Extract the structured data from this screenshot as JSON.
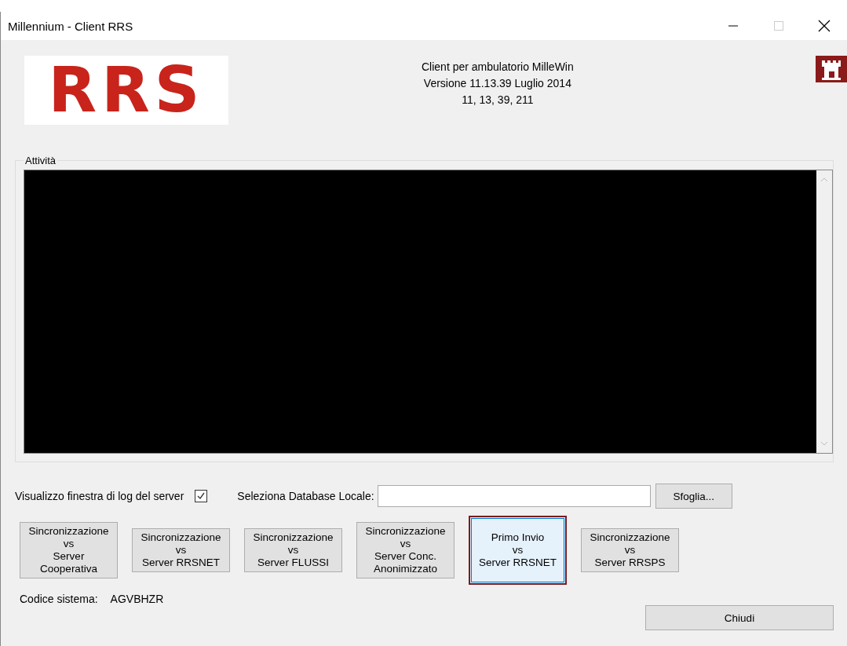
{
  "window": {
    "title": "Millennium - Client RRS"
  },
  "header": {
    "logo_text": "RRS",
    "info_lines": [
      "Client per ambulatorio MilleWin",
      "Versione 11.13.39  Luglio 2014",
      "11, 13, 39, 211"
    ]
  },
  "activity": {
    "label": "Attività"
  },
  "log_option": {
    "label": "Visualizzo finestra di log del server",
    "checked": true
  },
  "database": {
    "label": "Seleziona Database Locale:",
    "browse": "Sfoglia..."
  },
  "sync_buttons": [
    {
      "lines": [
        "Sincronizzazione",
        "vs",
        "Server",
        "Cooperativa"
      ],
      "selected": false
    },
    {
      "lines": [
        "Sincronizzazione",
        "vs",
        "Server RRSNET"
      ],
      "selected": false
    },
    {
      "lines": [
        "Sincronizzazione",
        "vs",
        "Server FLUSSI"
      ],
      "selected": false
    },
    {
      "lines": [
        "Sincronizzazione",
        "vs",
        "Server Conc.",
        "Anonimizzato"
      ],
      "selected": false
    },
    {
      "lines": [
        "Primo Invio",
        "vs",
        "Server RRSNET"
      ],
      "selected": true
    },
    {
      "lines": [
        "Sincronizzazione",
        "vs",
        "Server RRSPS"
      ],
      "selected": false
    }
  ],
  "system_code": {
    "label": "Codice sistema:",
    "value": "AGVBHZR"
  },
  "close_button": "Chiudi"
}
